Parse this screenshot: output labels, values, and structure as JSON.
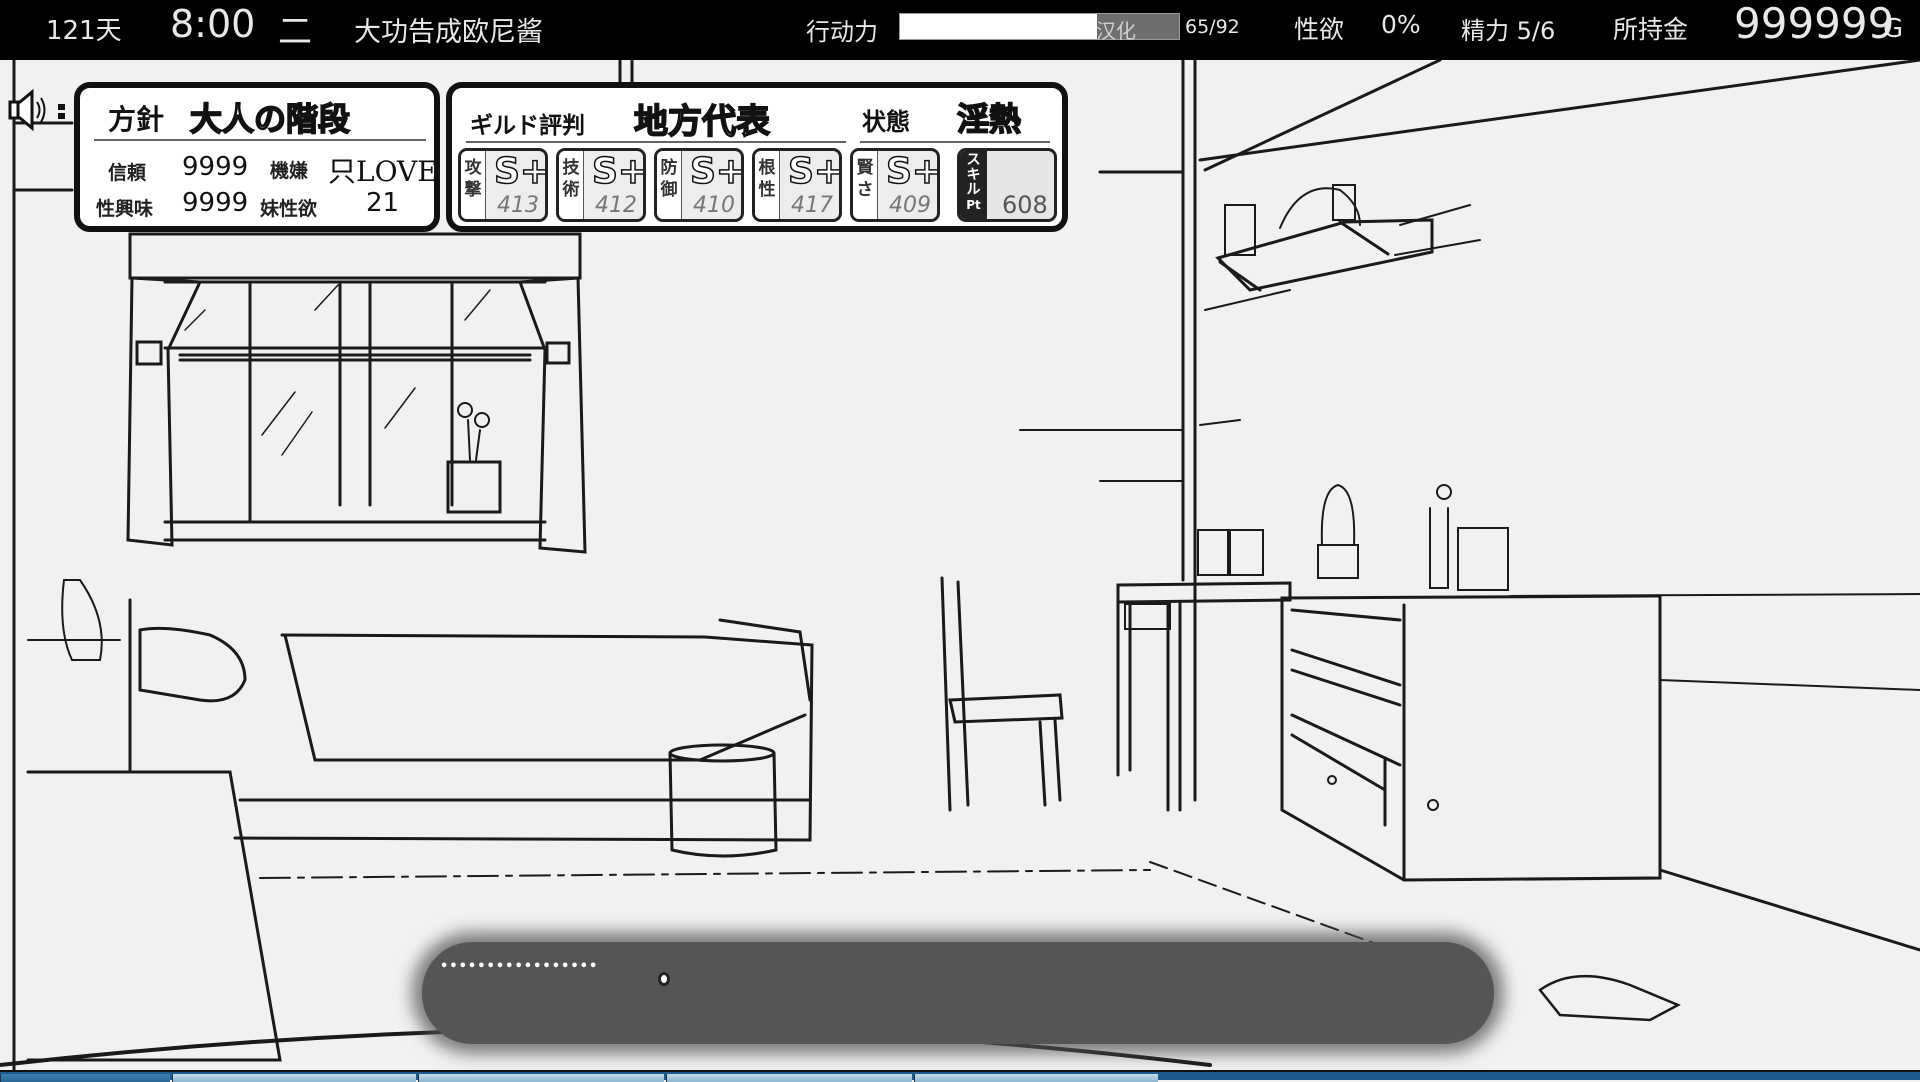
{
  "topbar": {
    "day": "121天",
    "time": "8:00",
    "weekday": "二",
    "status_message": "大功告成欧尼酱",
    "action_points_label": "行动力",
    "action_points_bar_text": "汉化",
    "action_points_current": 65,
    "action_points_max": 92,
    "action_points_value": "65/92",
    "action_points_fraction": 0.707,
    "lust_label": "性欲",
    "lust_value": "0%",
    "stamina": "精力 5/6",
    "gold_label": "所持金",
    "gold_value": "999999",
    "gold_unit": "G"
  },
  "speaker": {
    "icon": "speaker-icon"
  },
  "policy_panel": {
    "policy_label": "方針",
    "policy_value": "大人の階段",
    "trust_label": "信頼",
    "trust_value": "9999",
    "mood_label": "機嫌",
    "mood_value": "只LOVE",
    "sexual_interest_label": "性興味",
    "sexual_interest_value": "9999",
    "sister_lust_label": "妹性欲",
    "sister_lust_value": "21"
  },
  "guild_panel": {
    "reputation_label": "ギルド評判",
    "reputation_value": "地方代表",
    "condition_label": "状態",
    "condition_value": "淫熱",
    "stats": [
      {
        "label": "攻撃",
        "rank": "S+",
        "value": "413"
      },
      {
        "label": "技術",
        "rank": "S+",
        "value": "412"
      },
      {
        "label": "防御",
        "rank": "S+",
        "value": "410"
      },
      {
        "label": "根性",
        "rank": "S+",
        "value": "417"
      },
      {
        "label": "賢さ",
        "rank": "S+",
        "value": "409"
      }
    ],
    "skill": {
      "label": "スキルPt",
      "value": "608"
    }
  },
  "message_box": {
    "text": "•••••••••••••••••",
    "indicator": "next-page-indicator"
  },
  "colors": {
    "topbar_bg": "#000000",
    "scene_bg": "#f1f1f1",
    "panel_border": "#111111",
    "message_bg": "#555555",
    "taskbar": "#1f5a8f"
  }
}
